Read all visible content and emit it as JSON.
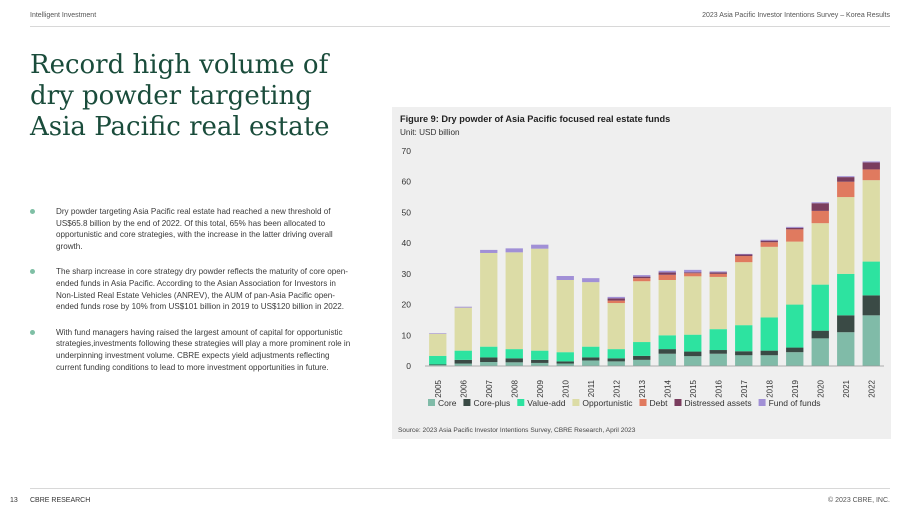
{
  "header": {
    "left": "Intelligent Investment",
    "right": "2023 Asia Pacific Investor Intentions Survey – Korea Results"
  },
  "page_title": "Record high volume of dry powder targeting Asia Pacific real estate",
  "bullets": [
    "Dry powder targeting Asia Pacific real estate had reached a new threshold of US$65.8 billion by the end of 2022. Of this total, 65% has been allocated to opportunistic and core strategies, with the increase in the latter driving overall growth.",
    "The sharp increase in core strategy dry powder reflects the maturity of core open-ended funds in Asia Pacific. According to the Asian Association for Investors in Non-Listed Real Estate Vehicles (ANREV), the AUM of pan-Asia Pacific open-ended funds rose by 10% from US$101 billion in 2019 to US$120 billion in 2022.",
    "With fund managers having raised the largest amount of capital for opportunistic strategies,investments following these strategies will play a more prominent role in underpinning investment volume. CBRE expects yield adjustments reflecting current funding conditions to lead to more investment opportunities in future."
  ],
  "chart_data": {
    "type": "bar",
    "stacked": true,
    "title": "Figure 9:  Dry powder of Asia Pacific focused real estate funds",
    "unit": "Unit: USD billion",
    "xlabel": "",
    "ylabel": "",
    "ylim": [
      0,
      70
    ],
    "yticks": [
      0,
      10,
      20,
      30,
      40,
      50,
      60,
      70
    ],
    "grid": false,
    "legend_position": "bottom",
    "categories": [
      "2005",
      "2006",
      "2007",
      "2008",
      "2009",
      "2010",
      "2011",
      "2012",
      "2013",
      "2014",
      "2015",
      "2016",
      "2017",
      "2018",
      "2019",
      "2020",
      "2021",
      "2022"
    ],
    "series": [
      {
        "name": "Core",
        "color": "#80bba8",
        "values": [
          0.3,
          0.8,
          1.3,
          1.2,
          1.0,
          0.8,
          1.8,
          1.5,
          2.0,
          4.0,
          3.2,
          4.0,
          3.5,
          3.5,
          4.5,
          9.0,
          11.0,
          16.5
        ]
      },
      {
        "name": "Core-plus",
        "color": "#3a4a45",
        "values": [
          0.2,
          1.2,
          1.5,
          1.3,
          1.0,
          0.7,
          1.0,
          1.0,
          1.3,
          1.5,
          1.5,
          1.2,
          1.3,
          1.5,
          1.5,
          2.5,
          5.5,
          6.5
        ]
      },
      {
        "name": "Value-add",
        "color": "#2de3a0",
        "values": [
          2.8,
          3.0,
          3.5,
          3.0,
          3.0,
          3.0,
          3.5,
          3.0,
          4.5,
          4.5,
          5.5,
          6.8,
          8.5,
          10.8,
          14.0,
          15.0,
          13.5,
          11.0
        ]
      },
      {
        "name": "Opportunistic",
        "color": "#dcdca6",
        "values": [
          7.2,
          14.0,
          30.5,
          31.5,
          33.2,
          23.5,
          21.0,
          15.0,
          19.8,
          18.0,
          19.0,
          17.0,
          20.5,
          23.0,
          20.5,
          20.0,
          25.0,
          26.5
        ]
      },
      {
        "name": "Debt",
        "color": "#e07a5f",
        "values": [
          0,
          0,
          0,
          0,
          0,
          0,
          0,
          0.8,
          1.0,
          1.7,
          1.0,
          1.0,
          2.0,
          1.5,
          4.0,
          4.0,
          5.0,
          3.5
        ]
      },
      {
        "name": "Distressed assets",
        "color": "#7a3d5e",
        "values": [
          0,
          0,
          0,
          0,
          0,
          0,
          0,
          0.7,
          0.5,
          0.8,
          0.3,
          0.5,
          0.5,
          0.5,
          0.5,
          2.5,
          1.5,
          2.3
        ]
      },
      {
        "name": "Fund of funds",
        "color": "#a190d6",
        "values": [
          0.2,
          0.3,
          1.0,
          1.3,
          1.3,
          1.3,
          1.3,
          0.5,
          0.5,
          0.5,
          0.8,
          0.3,
          0.2,
          0.3,
          0.3,
          0.3,
          0.3,
          0.3
        ]
      }
    ],
    "source": "Source: 2023 Asia Pacific Investor Intentions Survey, CBRE Research, April 2023"
  },
  "footer": {
    "page_number": "13",
    "left": "CBRE RESEARCH",
    "right": "© 2023 CBRE, INC."
  }
}
